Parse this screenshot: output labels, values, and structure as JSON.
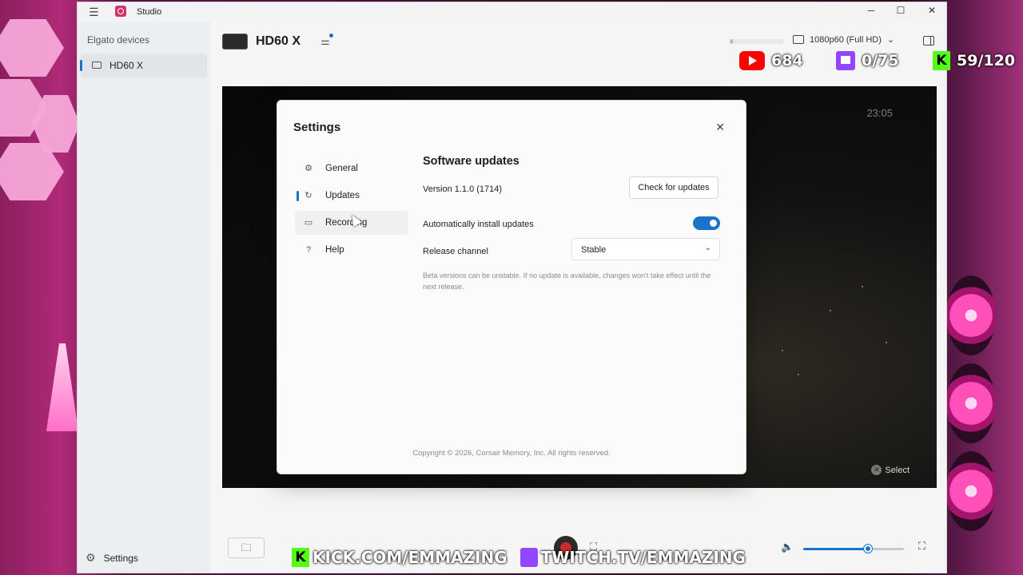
{
  "window": {
    "title": "Studio"
  },
  "sidebar": {
    "heading": "Elgato devices",
    "items": [
      {
        "label": "HD60 X"
      }
    ],
    "settings_label": "Settings"
  },
  "header": {
    "device_name": "HD60 X",
    "resolution": "1080p60 (Full HD)"
  },
  "preview": {
    "clock": "23:05",
    "select_hint": "Select"
  },
  "settings_modal": {
    "title": "Settings",
    "nav": [
      {
        "label": "General",
        "icon": "gear-icon"
      },
      {
        "label": "Updates",
        "icon": "refresh-icon"
      },
      {
        "label": "Recording",
        "icon": "camera-icon"
      },
      {
        "label": "Help",
        "icon": "help-icon"
      }
    ],
    "active_nav": "Updates",
    "content": {
      "heading": "Software updates",
      "version": "Version 1.1.0 (1714)",
      "check_button": "Check for updates",
      "auto_install_label": "Automatically install updates",
      "auto_install_enabled": true,
      "release_channel_label": "Release channel",
      "release_channel_value": "Stable",
      "note": "Beta versions can be unstable. If no update is available, changes won't take effect until the next release."
    },
    "copyright": "Copyright © 2026, Corsair Memory, Inc. All rights reserved."
  },
  "bottom_bar": {
    "volume_level": 0.64
  },
  "overlay": {
    "youtube_count": "684",
    "twitch_count": "0/75",
    "kick_count": "59/120",
    "kick_url": "KICK.COM/EMMAZING",
    "twitch_url": "TWITCH.TV/EMMAZING"
  },
  "colors": {
    "accent": "#1a73c9",
    "record": "#d12a2a",
    "youtube": "#ff0000",
    "twitch": "#9146ff",
    "kick": "#53fc18"
  }
}
